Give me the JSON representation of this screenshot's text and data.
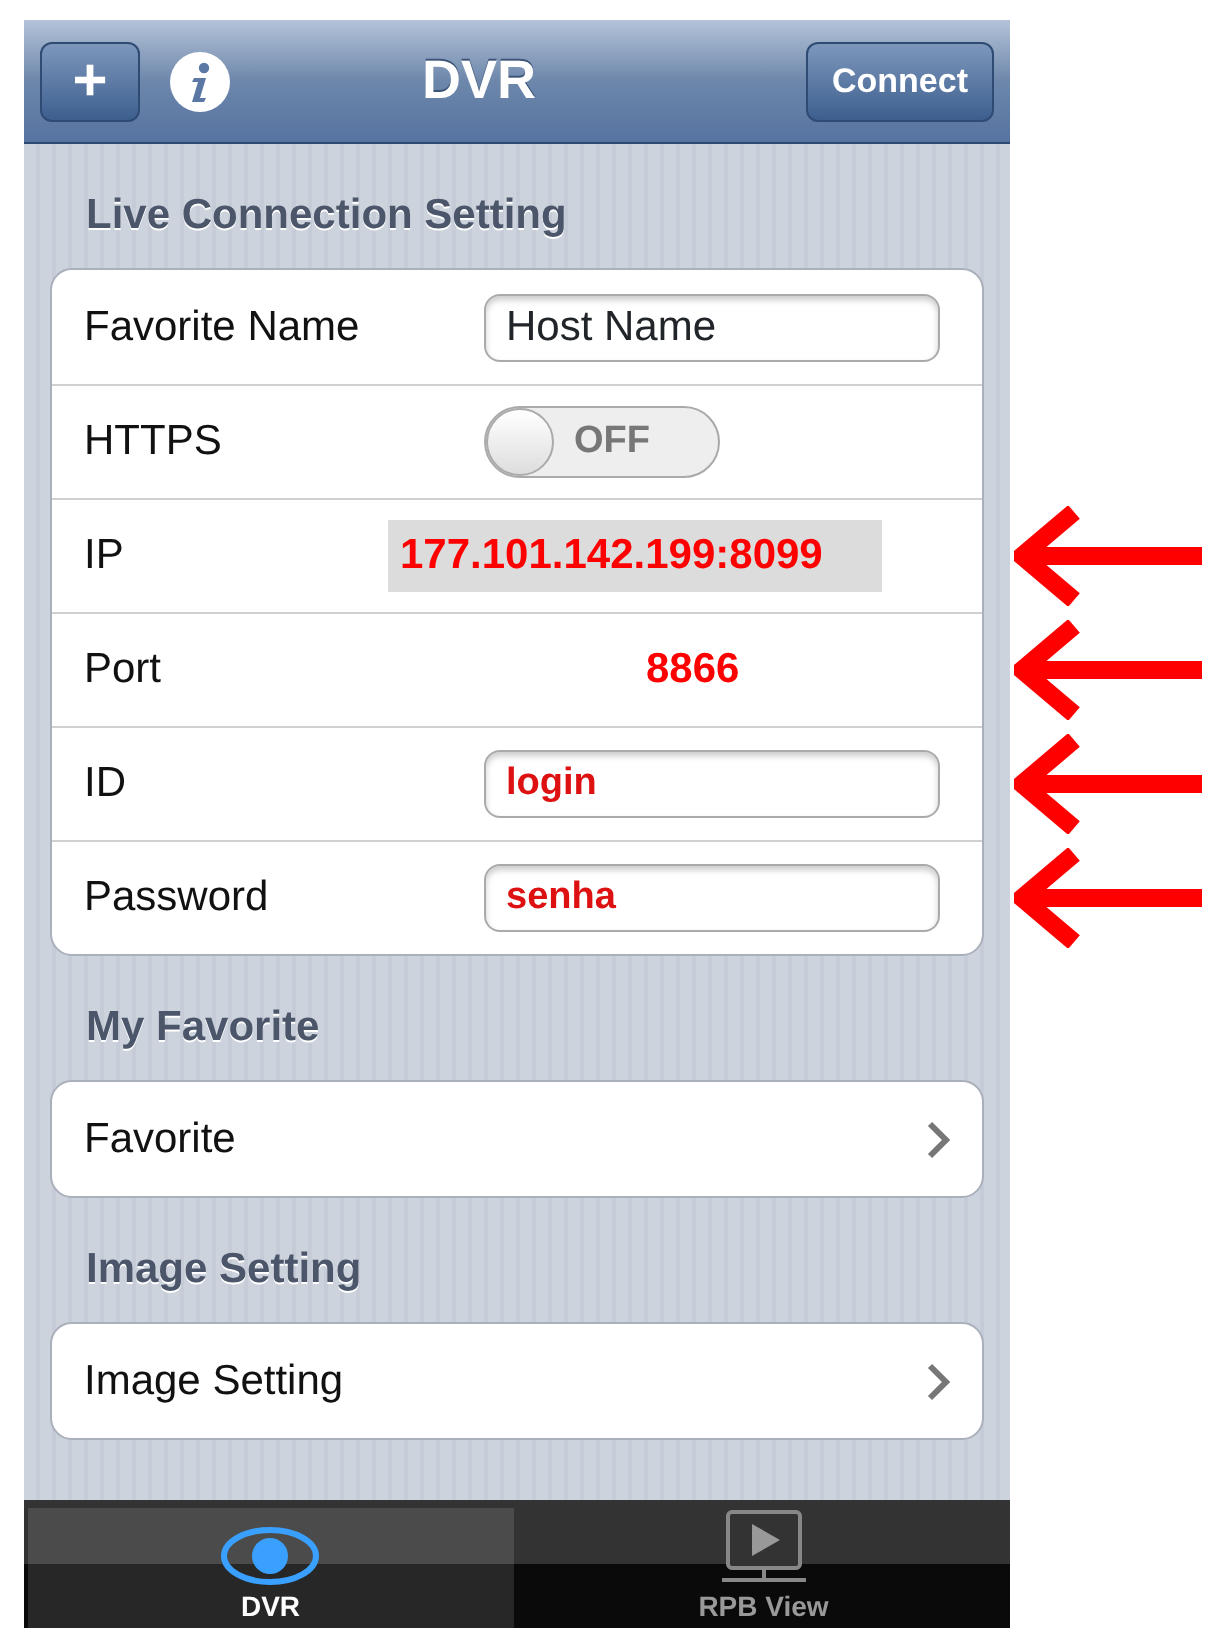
{
  "navbar": {
    "add_button": "+",
    "title": "DVR",
    "connect_button": "Connect"
  },
  "sections": [
    {
      "header": "Live Connection Setting",
      "rows": [
        {
          "kind": "field",
          "label": "Favorite Name",
          "value": "Host Name",
          "annotated": false,
          "marked": false
        },
        {
          "kind": "toggle",
          "label": "HTTPS",
          "on": false,
          "toggle_text": "OFF",
          "marked": false
        },
        {
          "kind": "text",
          "label": "IP",
          "value": "177.101.142.199:8099",
          "highlighted": true,
          "marked": true
        },
        {
          "kind": "text",
          "label": "Port",
          "value": "8866",
          "highlighted": false,
          "marked": true
        },
        {
          "kind": "field",
          "label": "ID",
          "value": "login",
          "annotated": true,
          "marked": true
        },
        {
          "kind": "field",
          "label": "Password",
          "value": "senha",
          "annotated": true,
          "marked": true
        }
      ]
    },
    {
      "header": "My Favorite",
      "rows": [
        {
          "kind": "link",
          "label": "Favorite",
          "marked": false
        }
      ]
    },
    {
      "header": "Image Setting",
      "rows": [
        {
          "kind": "link",
          "label": "Image Setting",
          "marked": false
        }
      ]
    }
  ],
  "tabs": [
    {
      "label": "DVR",
      "selected": true,
      "kind": "eye"
    },
    {
      "label": "RPB View",
      "selected": false,
      "kind": "monitor"
    }
  ]
}
